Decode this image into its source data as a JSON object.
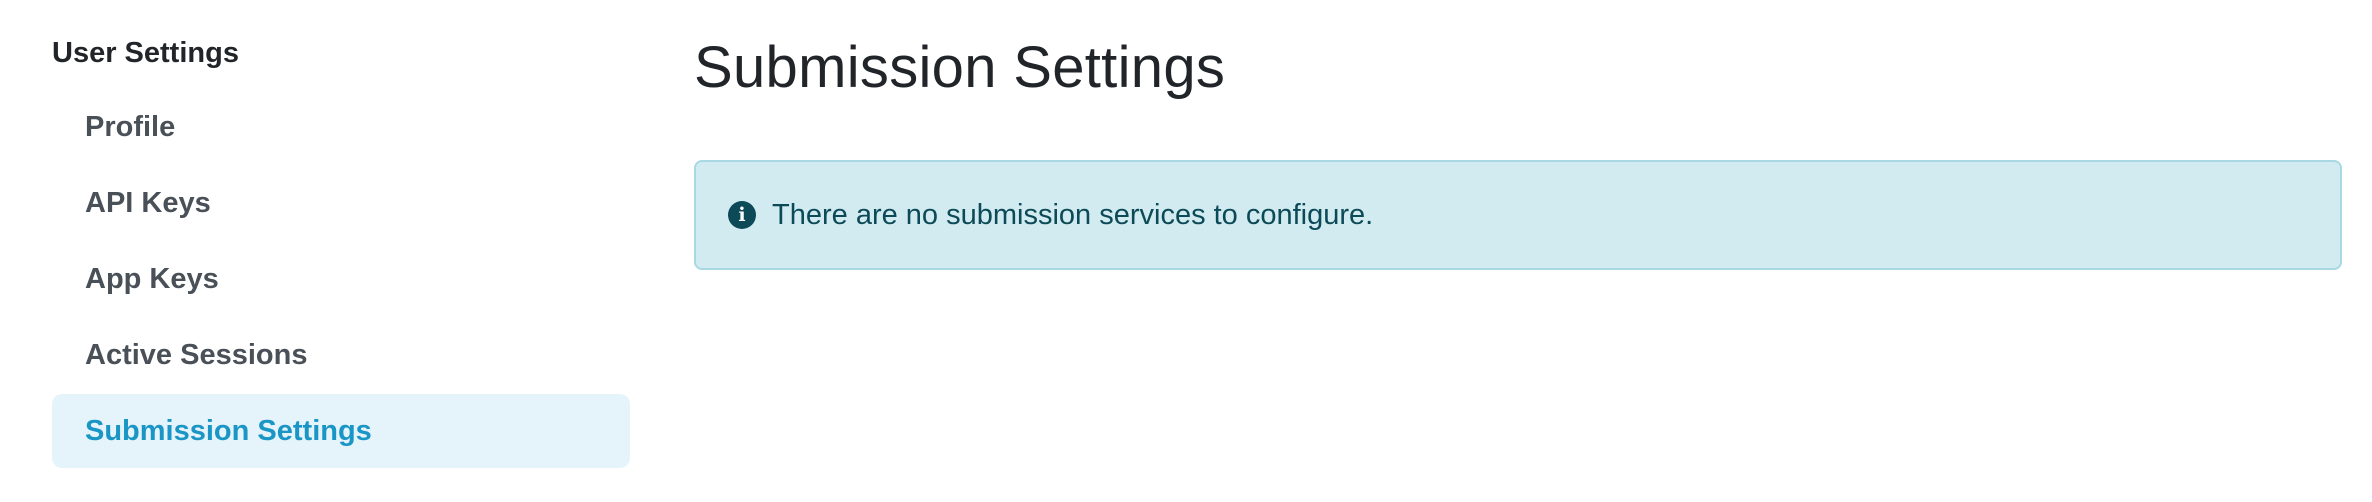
{
  "sidebar": {
    "heading": "User Settings",
    "items": [
      {
        "label": "Profile",
        "active": false
      },
      {
        "label": "API Keys",
        "active": false
      },
      {
        "label": "App Keys",
        "active": false
      },
      {
        "label": "Active Sessions",
        "active": false
      },
      {
        "label": "Submission Settings",
        "active": true
      }
    ]
  },
  "main": {
    "title": "Submission Settings",
    "alert": {
      "icon": "info-icon",
      "glyph": "i",
      "message": "There are no submission services to configure."
    }
  },
  "colors": {
    "active_item_bg": "#e5f3fa",
    "active_item_text": "#1a96c6",
    "alert_bg": "#d1ebf0",
    "alert_border": "#a8d8e3",
    "alert_text": "#0c4a57"
  }
}
